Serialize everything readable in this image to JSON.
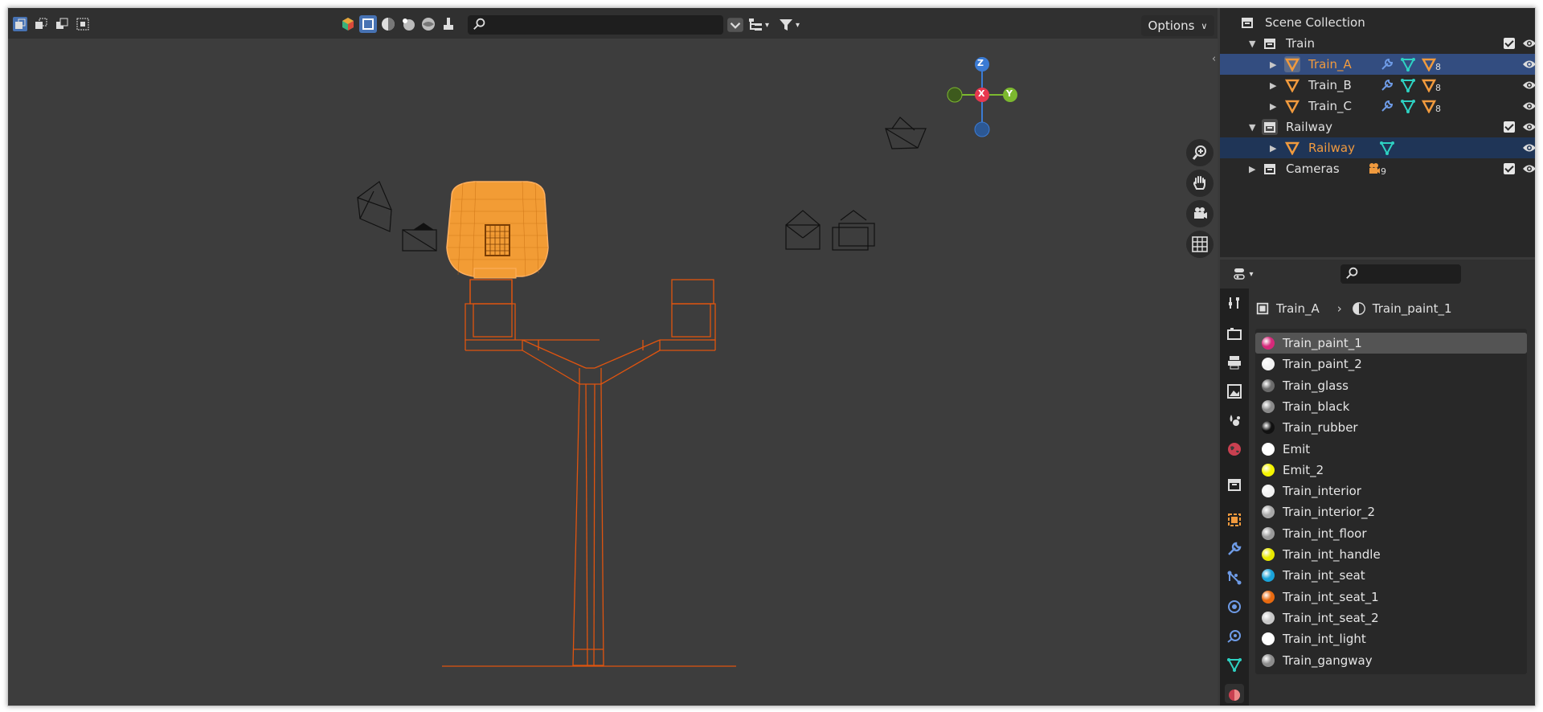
{
  "viewport": {
    "search_placeholder": "",
    "options_label": "Options",
    "gizmo": {
      "z": "Z",
      "x": "X",
      "y": "Y",
      "colors": {
        "x": "#e7384f",
        "y": "#7cb82f",
        "z": "#3b7bd4"
      }
    }
  },
  "outliner": {
    "rows": [
      {
        "label": "Scene Collection"
      },
      {
        "label": "Train"
      },
      {
        "label": "Train_A",
        "badge": "8"
      },
      {
        "label": "Train_B",
        "badge": "8"
      },
      {
        "label": "Train_C",
        "badge": "8"
      },
      {
        "label": "Railway"
      },
      {
        "label": "Railway"
      },
      {
        "label": "Cameras",
        "badge": "9"
      }
    ]
  },
  "properties": {
    "breadcrumb": {
      "object": "Train_A",
      "material": "Train_paint_1"
    },
    "materials": [
      {
        "name": "Train_paint_1",
        "color": "#d6297a"
      },
      {
        "name": "Train_paint_2",
        "color": "#f2f2f2"
      },
      {
        "name": "Train_glass",
        "color": "#6b6b6b"
      },
      {
        "name": "Train_black",
        "color": "#8a8a8a"
      },
      {
        "name": "Train_rubber",
        "color": "#111111"
      },
      {
        "name": "Emit",
        "color": "#ffffff"
      },
      {
        "name": "Emit_2",
        "color": "#f5f500"
      },
      {
        "name": "Train_interior",
        "color": "#f2f2f2"
      },
      {
        "name": "Train_interior_2",
        "color": "#a8a8a8"
      },
      {
        "name": "Train_int_floor",
        "color": "#9a9a9a"
      },
      {
        "name": "Train_int_handle",
        "color": "#e8e800"
      },
      {
        "name": "Train_int_seat",
        "color": "#1aa3d9"
      },
      {
        "name": "Train_int_seat_1",
        "color": "#e86a10"
      },
      {
        "name": "Train_int_seat_2",
        "color": "#c8c8c8"
      },
      {
        "name": "Train_int_light",
        "color": "#ffffff"
      },
      {
        "name": "Train_gangway",
        "color": "#8c8c8c"
      }
    ]
  },
  "colors": {
    "selection": "#f09a3e",
    "wire": "#e0540f"
  }
}
